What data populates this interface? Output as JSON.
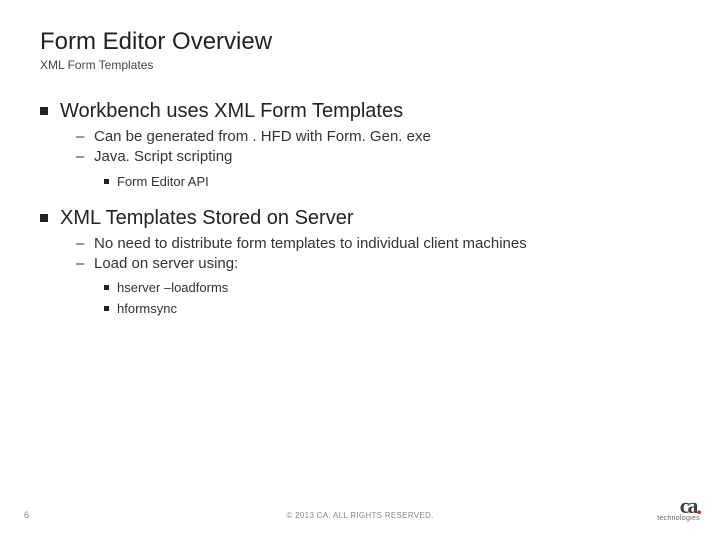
{
  "title": "Form Editor Overview",
  "subtitle": "XML Form Templates",
  "sections": [
    {
      "heading": "Workbench uses XML Form Templates",
      "sub": [
        {
          "text": "Can be generated from . HFD with Form. Gen. exe"
        },
        {
          "text": "Java. Script scripting"
        }
      ],
      "subsub": [
        {
          "text": "Form Editor API"
        }
      ]
    },
    {
      "heading": "XML Templates Stored on Server",
      "sub": [
        {
          "text": "No need to distribute form templates to individual client machines"
        },
        {
          "text": "Load on server using:"
        }
      ],
      "subsub": [
        {
          "text": "hserver –loadforms"
        },
        {
          "text": "hformsync"
        }
      ]
    }
  ],
  "footer": {
    "page": "6",
    "copyright": "© 2013 CA. ALL RIGHTS RESERVED.",
    "logo_main": "ca",
    "logo_tag": "technologies"
  }
}
